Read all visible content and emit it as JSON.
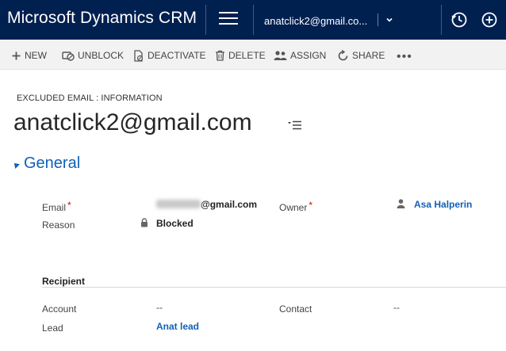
{
  "app": {
    "title": "Microsoft Dynamics CRM"
  },
  "nav": {
    "record_label": "anatclick2@gmail.co..."
  },
  "icons": {
    "hamburger": "hamburger-menu-icon",
    "chevron": "chevron-down-icon",
    "recent": "clock-icon",
    "create": "plus-circle-icon"
  },
  "commands": [
    {
      "label": "NEW",
      "icon": "plus-icon"
    },
    {
      "label": "UNBLOCK",
      "icon": "unblock-icon"
    },
    {
      "label": "DEACTIVATE",
      "icon": "deactivate-icon"
    },
    {
      "label": "DELETE",
      "icon": "trash-icon"
    },
    {
      "label": "ASSIGN",
      "icon": "assign-icon"
    },
    {
      "label": "SHARE",
      "icon": "share-icon"
    },
    {
      "label": "•••",
      "icon": "more-icon"
    }
  ],
  "header": {
    "entity_label": "EXCLUDED EMAIL : INFORMATION",
    "title": "anatclick2@gmail.com"
  },
  "section": {
    "title": "General"
  },
  "fields": {
    "email_label": "Email",
    "email_value_suffix": "@gmail.com",
    "reason_label": "Reason",
    "reason_value": "Blocked",
    "owner_label": "Owner",
    "owner_value": "Asa Halperin",
    "required_mark": "*"
  },
  "recipient": {
    "heading": "Recipient",
    "account_label": "Account",
    "account_value": "--",
    "contact_label": "Contact",
    "contact_value": "--",
    "lead_label": "Lead",
    "lead_value": "Anat lead"
  },
  "colors": {
    "topbar": "#002050",
    "accent": "#1160b7",
    "commandbar": "#f2f2f2",
    "required": "#dd0000"
  }
}
